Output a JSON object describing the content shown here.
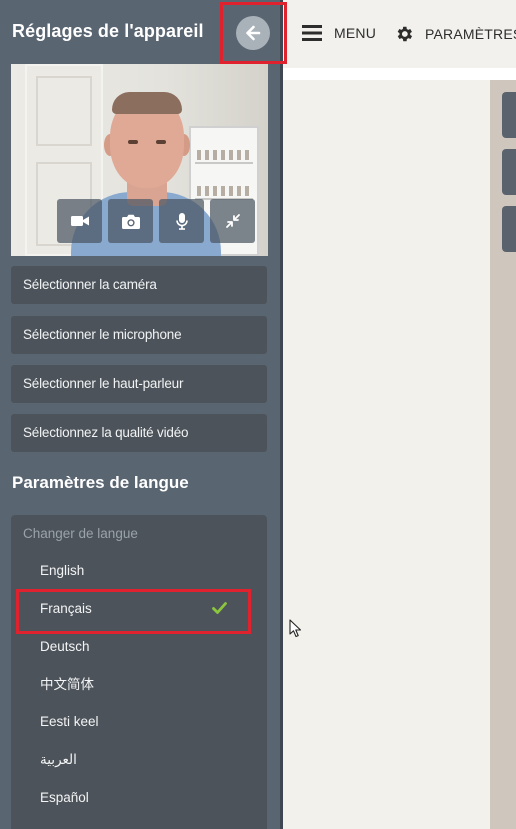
{
  "sidebar": {
    "title": "Réglages de l'appareil",
    "video_controls": [
      "camera-icon",
      "photo-icon",
      "microphone-icon",
      "minimize-icon"
    ],
    "buttons": [
      {
        "label": "Sélectionner la caméra"
      },
      {
        "label": "Sélectionner le microphone"
      },
      {
        "label": "Sélectionner le haut-parleur"
      },
      {
        "label": "Sélectionnez la qualité vidéo"
      }
    ],
    "language_section_title": "Paramètres de langue",
    "language_dropdown": {
      "placeholder": "Changer de langue",
      "selected": "Français",
      "options": [
        {
          "label": "English"
        },
        {
          "label": "Français"
        },
        {
          "label": "Deutsch"
        },
        {
          "label": "中文简体"
        },
        {
          "label": "Eesti keel"
        },
        {
          "label": "العربية"
        },
        {
          "label": "Español"
        }
      ]
    }
  },
  "topbar": {
    "menu_label": "MENU",
    "settings_label": "PARAMÈTRES"
  },
  "colors": {
    "sidebar_bg": "#5a6572",
    "button_bg": "#4c535a",
    "highlight": "#e0212e",
    "check": "#8cc63f"
  }
}
